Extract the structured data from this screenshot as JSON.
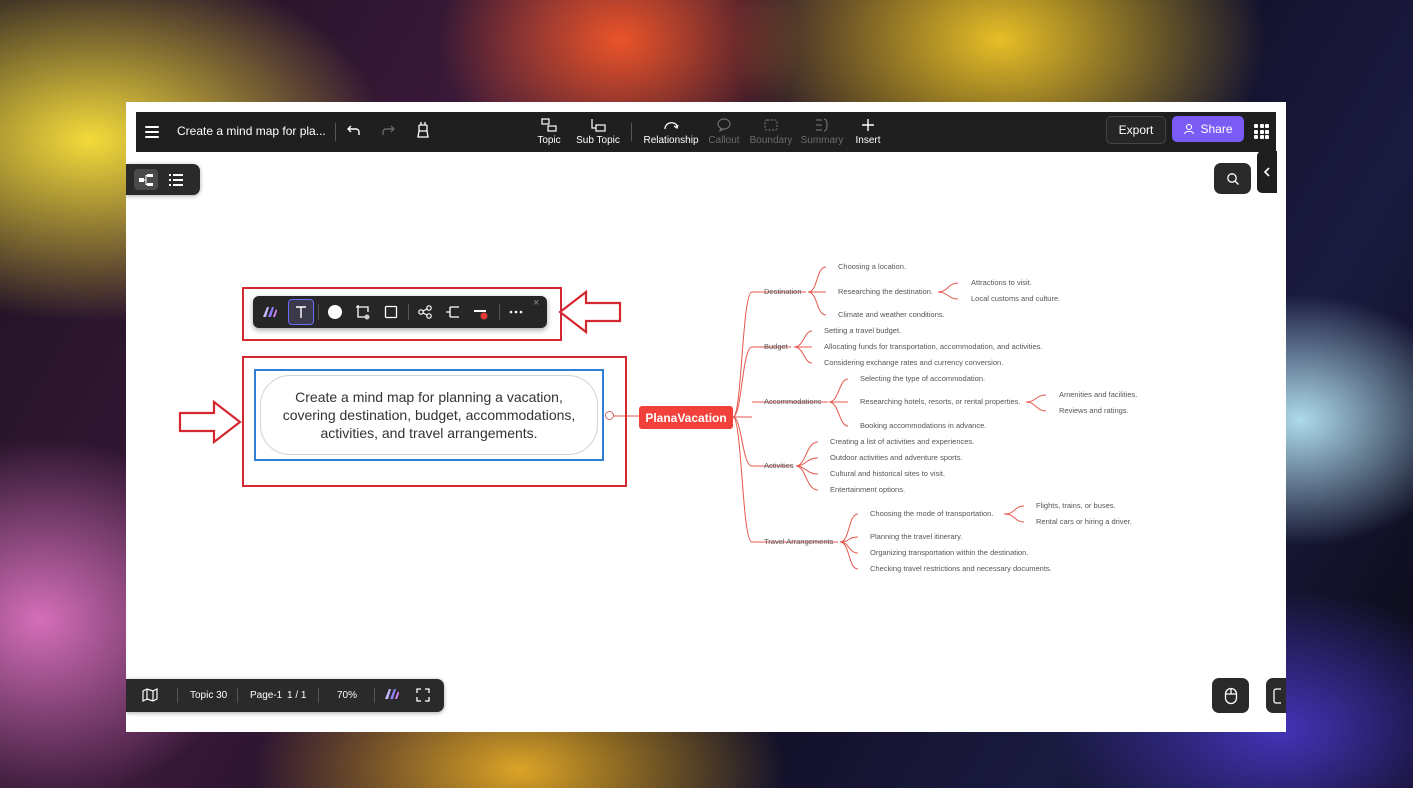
{
  "toolbar": {
    "doc_title": "Create a mind map for pla...",
    "tools": [
      {
        "label": "Topic",
        "enabled": true
      },
      {
        "label": "Sub Topic",
        "enabled": true
      },
      {
        "label": "Relationship",
        "enabled": true
      },
      {
        "label": "Callout",
        "enabled": false
      },
      {
        "label": "Boundary",
        "enabled": false
      },
      {
        "label": "Summary",
        "enabled": false
      },
      {
        "label": "Insert",
        "enabled": true
      }
    ],
    "export_label": "Export",
    "share_label": "Share"
  },
  "floating_toolbar": {
    "icons": [
      "ai-icon",
      "text-icon",
      "fill-circle-icon",
      "shape-frame-icon",
      "border-square-icon",
      "relationship-icon",
      "subtopic-icon",
      "line-color-icon",
      "more-icon",
      "close-icon"
    ],
    "close_glyph": "×"
  },
  "text_node": {
    "label": "Create a mind map for planning a vacation, covering destination, budget, accommodations, activities, and travel arrangements."
  },
  "mind_map": {
    "root": "PlanaVacation",
    "branches": {
      "destination": {
        "label": "Destination",
        "items": [
          "Choosing a location.",
          "Researching the destination.",
          "Climate and weather conditions."
        ],
        "sub": [
          "Attractions to visit.",
          "Local customs and culture."
        ]
      },
      "budget": {
        "label": "Budget",
        "items": [
          "Setting a travel budget.",
          "Allocating funds for transportation, accommodation, and activities.",
          "Considering exchange rates and currency conversion."
        ]
      },
      "accommodations": {
        "label": "Accommodations",
        "items": [
          "Selecting the type of accommodation.",
          "Researching hotels, resorts, or rental properties.",
          "Booking accommodations in advance."
        ],
        "sub": [
          "Amenities and facilities.",
          "Reviews and ratings."
        ]
      },
      "activities": {
        "label": "Activities",
        "items": [
          "Creating a list of activities and experiences.",
          "Outdoor activities and adventure sports.",
          "Cultural and historical sites to visit.",
          "Entertainment options."
        ]
      },
      "travel": {
        "label": "Travel Arrangements",
        "items": [
          "Choosing the mode of transportation.",
          "Planning the travel itinerary.",
          "Organizing transportation within the destination.",
          "Checking travel restrictions and necessary documents."
        ],
        "sub": [
          "Flights, trains, or buses.",
          "Rental cars or hiring a driver."
        ]
      }
    }
  },
  "status_bar": {
    "topic_count": "Topic 30",
    "page": "Page-1",
    "page_count": "1 / 1",
    "zoom": "70%"
  },
  "colors": {
    "accent": "#7a5cf5",
    "root": "#f2403a",
    "annotation_red": "#d5272f",
    "selection_blue": "#2f7fd6"
  }
}
